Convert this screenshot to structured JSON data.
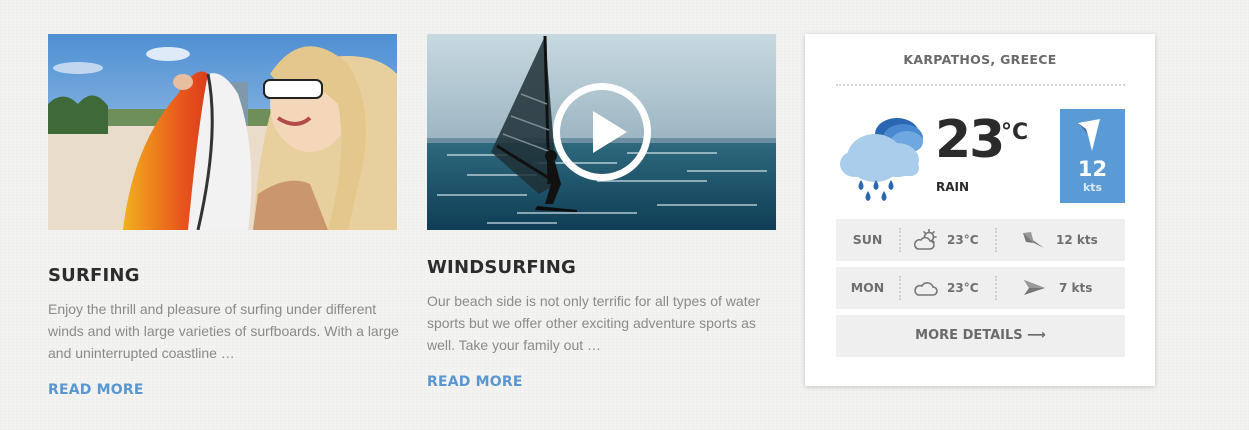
{
  "cards": [
    {
      "title": "SURFING",
      "text": "Enjoy the thrill and pleasure of surfing under different winds and with large varieties of surfboards. With a large and uninterrupted coastline …",
      "read_more": "READ MORE"
    },
    {
      "title": "WINDSURFING",
      "text": "Our beach side is not only terrific for all types of water sports but we offer other exciting adventure sports as well. Take your family out …",
      "read_more": "READ MORE"
    }
  ],
  "weather": {
    "location": "KARPATHOS, GREECE",
    "temperature": "23",
    "unit": "°C",
    "condition": "RAIN",
    "condition_icon": "rain-cloud-icon",
    "wind_speed": "12",
    "wind_unit": "kts",
    "forecast": [
      {
        "day": "SUN",
        "icon": "partly-sunny-icon",
        "temp": "23°C",
        "wind": "12 kts"
      },
      {
        "day": "MON",
        "icon": "cloud-icon",
        "temp": "23°C",
        "wind": "7 kts"
      }
    ],
    "more_details": "MORE DETAILS ⟶"
  },
  "colors": {
    "accent": "#5a96cf",
    "wind_box": "#5b9bd5",
    "heading": "#2c2c2c",
    "body_text": "#8a8a8a"
  }
}
